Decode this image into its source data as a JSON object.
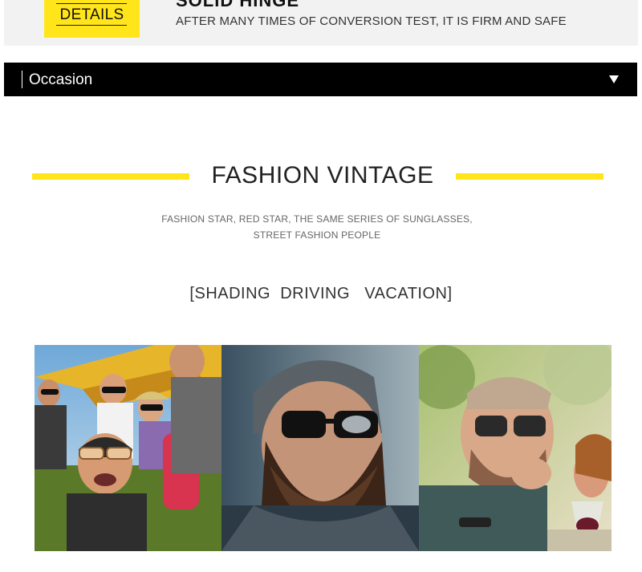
{
  "detail": {
    "badge_label": "DETAILS",
    "heading": "SOLID HINGE",
    "description": "AFTER MANY TIMES OF CONVERSION TEST, IT IS FIRM AND SAFE"
  },
  "occasion": {
    "label": "Occasion",
    "arrow_icon": "triangle-down-icon"
  },
  "section": {
    "title": "FASHION VINTAGE",
    "subtitle_line1": "FASHION STAR, RED STAR, THE SAME SERIES OF SUNGLASSES,",
    "subtitle_line2": "STREET FASHION PEOPLE",
    "tagline": "[SHADING  DRIVING   VACATION]"
  },
  "colors": {
    "accent_yellow": "#ffe51a",
    "bar_black": "#000000",
    "strip_gray": "#f2f2f2"
  },
  "photos": [
    {
      "name": "group-photo",
      "description_icon": "photo-icon"
    },
    {
      "name": "bearded-man-photo",
      "description_icon": "photo-icon"
    },
    {
      "name": "dining-man-photo",
      "description_icon": "photo-icon"
    }
  ]
}
